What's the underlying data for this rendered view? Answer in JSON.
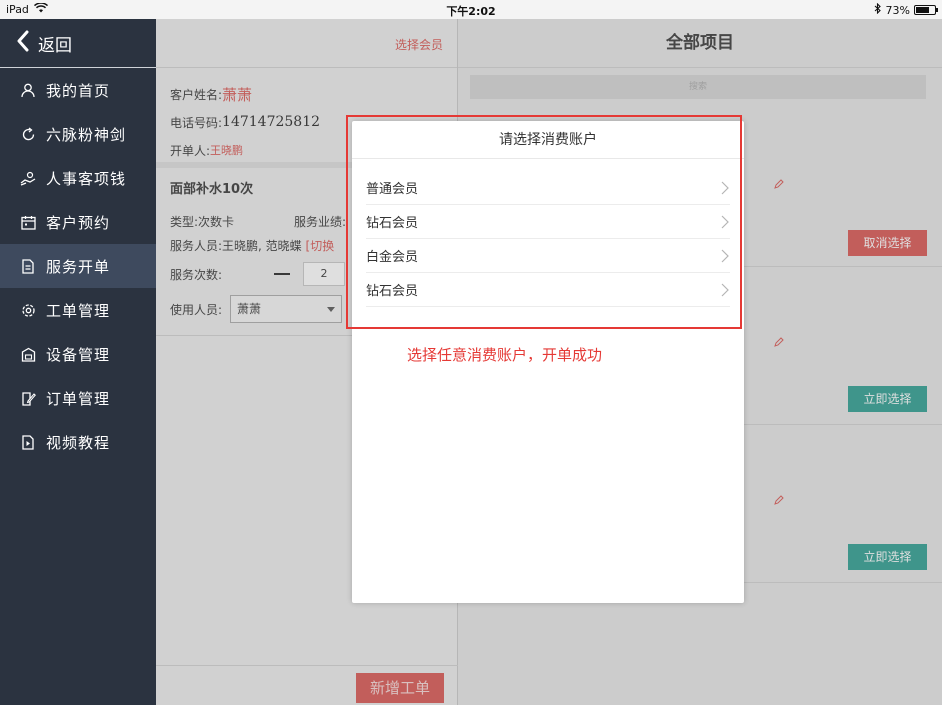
{
  "statusbar": {
    "device": "iPad",
    "time": "下午2:02",
    "battery": "73%",
    "battery_level": 0.73
  },
  "sidebar": {
    "back_label": "返回",
    "items": [
      {
        "label": "我的首页",
        "icon": "person-icon"
      },
      {
        "label": "六脉粉神剑",
        "icon": "refresh-icon"
      },
      {
        "label": "人事客项钱",
        "icon": "hand-coin-icon"
      },
      {
        "label": "客户预约",
        "icon": "calendar-icon"
      },
      {
        "label": "服务开单",
        "icon": "document-icon"
      },
      {
        "label": "工单管理",
        "icon": "gear-icon"
      },
      {
        "label": "设备管理",
        "icon": "device-icon"
      },
      {
        "label": "订单管理",
        "icon": "edit-doc-icon"
      },
      {
        "label": "视频教程",
        "icon": "video-icon"
      }
    ]
  },
  "order": {
    "select_member": "选择会员",
    "customer_label": "客户姓名:",
    "customer_name": "萧萧",
    "phone_label": "电话号码:",
    "phone": "14714725812",
    "opener_label": "开单人:",
    "opener": "王晓鹏",
    "service_title": "面部补水10次",
    "type_label": "类型:",
    "type_value": "次数卡",
    "perf_label": "服务业绩:",
    "staff_label": "服务人员:",
    "staff_value": "王晓鹏, 范晓蝶",
    "staff_switch": "[切换",
    "count_label": "服务次数:",
    "count_value": "2",
    "user_label": "使用人员:",
    "user_value": "萧萧",
    "new_order": "新增工单"
  },
  "projects": {
    "title": "全部项目",
    "search_placeholder": "搜索",
    "cards": [
      {
        "button": "取消选择"
      },
      {
        "button": "立即选择"
      },
      {
        "button": "立即选择"
      }
    ]
  },
  "modal": {
    "title": "请选择消费账户",
    "accounts": [
      "普通会员",
      "钻石会员",
      "白金会员",
      "钻石会员"
    ]
  },
  "annotation": "选择任意消费账户，开单成功",
  "colors": {
    "sidebar_bg": "#2b3340",
    "accent_red": "#d9534f",
    "accent_teal": "#2a9d8f",
    "highlight": "#e53935"
  }
}
